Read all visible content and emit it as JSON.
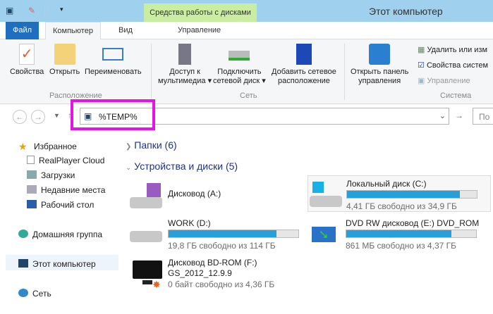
{
  "window": {
    "title": "Этот компьютер",
    "context_tab_group": "Средства работы с дисками"
  },
  "tabs": [
    {
      "label": "Файл"
    },
    {
      "label": "Компьютер"
    },
    {
      "label": "Вид"
    },
    {
      "label": "Управление"
    }
  ],
  "ribbon": {
    "location": {
      "label": "Расположение",
      "buttons": [
        "Свойства",
        "Открыть",
        "Переименовать"
      ]
    },
    "network": {
      "label": "Сеть",
      "buttons": [
        [
          "Доступ к",
          "мультимедиа ▾"
        ],
        [
          "Подключить",
          "сетевой диск ▾"
        ],
        [
          "Добавить сетевое",
          "расположение"
        ]
      ]
    },
    "system": {
      "label": "Система",
      "open_panel": [
        "Открыть панель",
        "управления"
      ],
      "small": [
        "Удалить или изм",
        "Свойства систем",
        "Управление"
      ]
    }
  },
  "address": {
    "value": "%TEMP%",
    "search_placeholder": "По"
  },
  "sidebar": {
    "items": [
      "Избранное",
      "RealPlayer Cloud",
      "Загрузки",
      "Недавние места",
      "Рабочий стол",
      "Домашняя группа",
      "Этот компьютер",
      "Сеть"
    ]
  },
  "groups": {
    "folders": "Папки (6)",
    "devices": "Устройства и диски (5)"
  },
  "drives": [
    {
      "name": "Дисковод (A:)"
    },
    {
      "name": "Локальный диск (C:)",
      "used_fraction": 0.87,
      "free": "4,41 ГБ свободно из 34,9 ГБ"
    },
    {
      "name": "WORK (D:)",
      "used_fraction": 0.83,
      "free": "19,8 ГБ свободно из 114 ГБ"
    },
    {
      "name": "DVD RW дисковод (E:) DVD_ROM",
      "used_fraction": 0.81,
      "free": "861 МБ свободно из 4,37 ГБ"
    },
    {
      "name": "Дисковод BD-ROM (F:)",
      "label": "GS_2012_12.9.9",
      "free": "0 байт свободно из 4,36 ГБ"
    }
  ],
  "colors": {
    "accent": "#1f6fc0",
    "bar": "#26a0da",
    "highlight": "#e414e4"
  }
}
